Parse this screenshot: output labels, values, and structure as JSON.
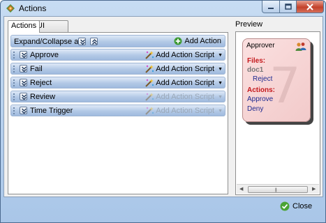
{
  "window": {
    "title": "Actions"
  },
  "tabs": [
    {
      "label": "Actions"
    },
    {
      "label": "UI Settings"
    }
  ],
  "header": {
    "expand_collapse_label": "Expand/Collapse all:",
    "add_action_label": "Add Action"
  },
  "actions": [
    {
      "name": "Approve",
      "script_label": "Add Action Script",
      "enabled": true
    },
    {
      "name": "Fail",
      "script_label": "Add Action Script",
      "enabled": true
    },
    {
      "name": "Reject",
      "script_label": "Add Action Script",
      "enabled": true
    },
    {
      "name": "Review",
      "script_label": "Add Action Script",
      "enabled": false
    },
    {
      "name": "Time Trigger",
      "script_label": "Add Action Script",
      "enabled": false
    }
  ],
  "preview": {
    "label": "Preview",
    "card": {
      "title": "Approver",
      "files_label": "Files:",
      "file_name": "doc1",
      "file_action": "Reject",
      "actions_label": "Actions:",
      "action_items": [
        "Approve",
        "Deny"
      ]
    }
  },
  "footer": {
    "close_label": "Close"
  },
  "colors": {
    "accent_blue": "#1e2a90",
    "label_red": "#c4171b",
    "card_pink": "#f7d6d6"
  }
}
